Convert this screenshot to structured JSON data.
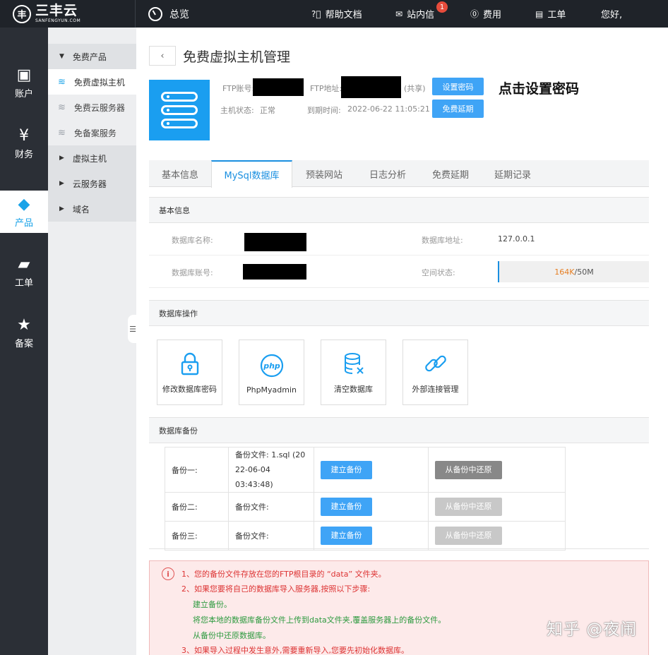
{
  "topbar": {
    "logo_cn": "三丰云",
    "logo_en": "SANFENGYUN.COM",
    "overview": "总览",
    "help": "帮助文档",
    "messages": "站内信",
    "message_count": "1",
    "fees": "费用",
    "tickets": "工单",
    "greeting": "您好,"
  },
  "rail": [
    {
      "label": "账户",
      "icon": "account-icon"
    },
    {
      "label": "财务",
      "icon": "finance-icon"
    },
    {
      "label": "产品",
      "icon": "product-icon"
    },
    {
      "label": "工单",
      "icon": "ticket-icon"
    },
    {
      "label": "备案",
      "icon": "record-icon"
    }
  ],
  "submenu": {
    "group_free": "免费产品",
    "items": [
      "免费虚拟主机",
      "免费云服务器",
      "免备案服务"
    ],
    "group_vhost": "虚拟主机",
    "group_cloud": "云服务器",
    "group_domain": "域名"
  },
  "page": {
    "title": "免费虚拟主机管理",
    "callout": "点击设置密码"
  },
  "host": {
    "ftp_account_label": "FTP账号:",
    "ftp_addr_label": "FTP地址:",
    "shared_tag": "(共享)",
    "status_label": "主机状态:",
    "status": "正常",
    "expire_label": "到期时间:",
    "expire": "2022-06-22 11:05:21",
    "set_pwd_btn": "设置密码",
    "extend_btn": "免费延期"
  },
  "tabs": [
    "基本信息",
    "MySql数据库",
    "预装网站",
    "日志分析",
    "免费延期",
    "延期记录"
  ],
  "db_info": {
    "section": "基本信息",
    "name_label": "数据库名称:",
    "addr_label": "数据库地址:",
    "addr": "127.0.0.1",
    "account_label": "数据库账号:",
    "space_label": "空间状态:",
    "space_used": "164K",
    "space_total": "/50M",
    "space_used_fraction": 0.003
  },
  "ops": {
    "section": "数据库操作",
    "cards": [
      "修改数据库密码",
      "PhpMyadmin",
      "清空数据库",
      "外部连接管理"
    ]
  },
  "backup": {
    "section": "数据库备份",
    "rows": [
      {
        "name": "备份一:",
        "file": "备份文件: 1.sql (20",
        "file2": "22-06-04 03:43:48)",
        "create": "建立备份",
        "restore": "从备份中还原"
      },
      {
        "name": "备份二:",
        "file": "备份文件:",
        "create": "建立备份",
        "restore": "从备份中还原"
      },
      {
        "name": "备份三:",
        "file": "备份文件:",
        "create": "建立备份",
        "restore": "从备份中还原"
      }
    ]
  },
  "notice": {
    "l1": "1、您的备份文件存放在您的FTP根目录的 “data” 文件夹。",
    "l2": "2、如果您要将自己的数据库导入服务器,按照以下步骤:",
    "l3": "建立备份。",
    "l4": "将您本地的数据库备份文件上传到data文件夹,覆盖服务器上的备份文件。",
    "l5": "从备份中还原数据库。",
    "l6": "3、如果导入过程中发生意外,需要重新导入,您要先初始化数据库。"
  },
  "watermark": "知乎 @夜闹"
}
